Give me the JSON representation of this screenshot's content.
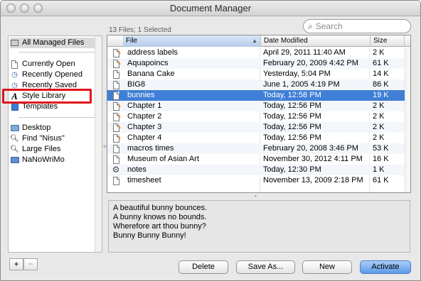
{
  "window": {
    "title": "Document Manager"
  },
  "search": {
    "placeholder": "Search"
  },
  "status": {
    "file_count": "13 Files; 1 Selected"
  },
  "sidebar": {
    "groups": [
      {
        "items": [
          {
            "label": "All Managed Files",
            "icon": "drawer-icon",
            "selected": true
          }
        ]
      },
      {
        "items": [
          {
            "label": "Currently Open",
            "icon": "document-icon"
          },
          {
            "label": "Recently Opened",
            "icon": "clock-icon"
          },
          {
            "label": "Recently Saved",
            "icon": "clock-icon"
          },
          {
            "label": "Style Library",
            "icon": "style-a-icon"
          },
          {
            "label": "Templates",
            "icon": "template-icon"
          }
        ]
      },
      {
        "items": [
          {
            "label": "Desktop",
            "icon": "folder-icon"
          },
          {
            "label": "Find \"Nisus\"",
            "icon": "magnifier-icon"
          },
          {
            "label": "Large Files",
            "icon": "magnifier-icon"
          },
          {
            "label": "NaNoWriMo",
            "icon": "smart-folder-icon"
          }
        ]
      }
    ],
    "highlighted_item": "Style Library"
  },
  "table": {
    "columns": [
      "File",
      "Date Modified",
      "Size"
    ],
    "sorted_column": "File",
    "rows": [
      {
        "name": "address labels",
        "date": "April 29, 2011 11:40 AM",
        "size": "2 K",
        "icon": "pencil-doc-icon"
      },
      {
        "name": "Aquapoincs",
        "date": "February 20, 2009 4:42 PM",
        "size": "61 K",
        "icon": "pencil-doc-icon"
      },
      {
        "name": "Banana Cake",
        "date": "Yesterday, 5:04 PM",
        "size": "14 K",
        "icon": "doc-icon"
      },
      {
        "name": "BIG8",
        "date": "June 1, 2005 4:19 PM",
        "size": "86 K",
        "icon": "doc-icon"
      },
      {
        "name": "bunnies",
        "date": "Today, 12:58 PM",
        "size": "19 K",
        "icon": "doc-icon",
        "selected": true
      },
      {
        "name": "Chapter 1",
        "date": "Today, 12:56 PM",
        "size": "2 K",
        "icon": "pencil-doc-icon"
      },
      {
        "name": "Chapter 2",
        "date": "Today, 12:56 PM",
        "size": "2 K",
        "icon": "pencil-doc-icon"
      },
      {
        "name": "Chapter 3",
        "date": "Today, 12:56 PM",
        "size": "2 K",
        "icon": "pencil-doc-icon"
      },
      {
        "name": "Chapter 4",
        "date": "Today, 12:56 PM",
        "size": "2 K",
        "icon": "pencil-doc-icon"
      },
      {
        "name": "macros times",
        "date": "February 20, 2008 3:46 PM",
        "size": "53 K",
        "icon": "doc-icon"
      },
      {
        "name": "Museum of Asian Art",
        "date": "November 30, 2012 4:11 PM",
        "size": "16 K",
        "icon": "doc-icon"
      },
      {
        "name": "notes",
        "date": "Today, 12:30 PM",
        "size": "1 K",
        "icon": "gear-doc-icon"
      },
      {
        "name": "timesheet",
        "date": "November 13, 2009 2:18 PM",
        "size": "61 K",
        "icon": "doc-icon"
      }
    ]
  },
  "preview": {
    "lines": [
      "A beautiful bunny bounces.",
      "A bunny knows no bounds.",
      "Wherefore art thou bunny?",
      "Bunny Bunny Bunny!"
    ]
  },
  "buttons": {
    "add": "+",
    "remove": "−",
    "delete": "Delete",
    "save_as": "Save As...",
    "new": "New",
    "activate": "Activate"
  },
  "colors": {
    "selection": "#3f7fd6",
    "highlight_box": "#e0141c",
    "primary_button": "#5c9ae8"
  }
}
